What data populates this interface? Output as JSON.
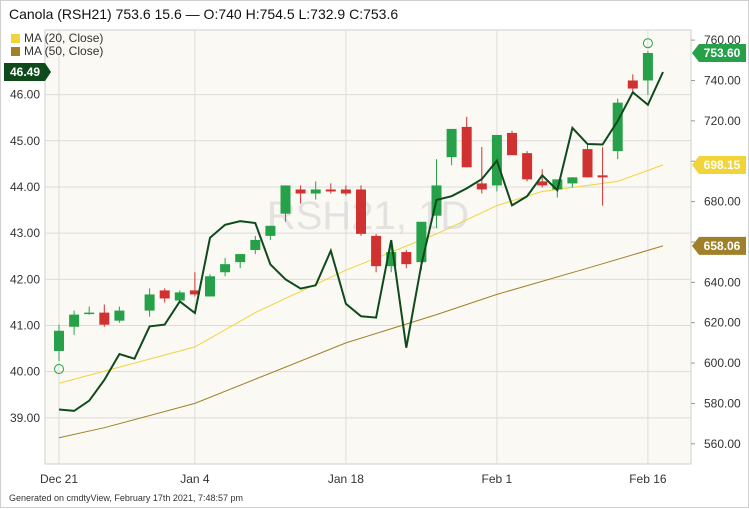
{
  "header": {
    "title": "Canola (RSH21) 753.6 15.6 — O:740 H:754.5 L:732.9 C:753.6"
  },
  "footer": {
    "text": "Generated on cmdtyView, February 17th 2021, 7:48:57 pm"
  },
  "colors": {
    "up": "#26a14a",
    "down": "#d03232",
    "oscillator": "#0f4a1c",
    "ma20": "#f0d43a",
    "ma50": "#a0812a",
    "grid": "#dcdcdc",
    "plot_bg": "#fbf9f3",
    "watermark": "#d9d9d9"
  },
  "chart_data": {
    "type": "candlestick",
    "title": "Canola (RSH21)",
    "watermark": "RSH21, 1D",
    "x_labels": [
      {
        "label": "Dec 21",
        "index": 0
      },
      {
        "label": "Jan 4",
        "index": 9
      },
      {
        "label": "Jan 18",
        "index": 19
      },
      {
        "label": "Feb 1",
        "index": 29
      },
      {
        "label": "Feb 16",
        "index": 39
      }
    ],
    "left_axis": {
      "ticks": [
        "39.00",
        "40.00",
        "41.00",
        "42.00",
        "43.00",
        "44.00",
        "45.00",
        "46.00"
      ],
      "range": [
        38.0,
        47.4
      ],
      "current_label": "46.49",
      "current_value": 46.49,
      "current_color": "#0f4a1c"
    },
    "right_axis": {
      "ticks": [
        "560.00",
        "580.00",
        "600.00",
        "620.00",
        "640.00",
        "660.00",
        "680.00",
        "700.00",
        "720.00",
        "740.00",
        "760.00"
      ],
      "range": [
        550.0,
        765.0
      ],
      "labels": [
        {
          "text": "753.60",
          "value": 753.6,
          "color": "#26a14a",
          "text_color": "#ffffff"
        },
        {
          "text": "698.15",
          "value": 698.15,
          "color": "#f0d43a",
          "text_color": "#ffffff"
        },
        {
          "text": "658.06",
          "value": 658.06,
          "color": "#a0812a",
          "text_color": "#ffffff"
        }
      ]
    },
    "legend": [
      {
        "name": "MA (20, Close)",
        "color": "#f0d43a"
      },
      {
        "name": "MA (50, Close)",
        "color": "#a0812a"
      }
    ],
    "candles": [
      {
        "i": 0,
        "o": 606,
        "h": 619,
        "l": 601,
        "c": 616
      },
      {
        "i": 1,
        "o": 618,
        "h": 626,
        "l": 614,
        "c": 624
      },
      {
        "i": 2,
        "o": 625,
        "h": 628,
        "l": 624,
        "c": 625
      },
      {
        "i": 3,
        "o": 625,
        "h": 629,
        "l": 618,
        "c": 619
      },
      {
        "i": 4,
        "o": 621,
        "h": 628,
        "l": 620,
        "c": 626
      },
      {
        "i": 6,
        "o": 626,
        "h": 637,
        "l": 623,
        "c": 634
      },
      {
        "i": 7,
        "o": 636,
        "h": 637,
        "l": 630,
        "c": 632
      },
      {
        "i": 8,
        "o": 631,
        "h": 636,
        "l": 630,
        "c": 635
      },
      {
        "i": 9,
        "o": 636,
        "h": 645,
        "l": 633,
        "c": 634
      },
      {
        "i": 10,
        "o": 633,
        "h": 644,
        "l": 633,
        "c": 643
      },
      {
        "i": 11,
        "o": 645,
        "h": 652,
        "l": 643,
        "c": 649
      },
      {
        "i": 12,
        "o": 650,
        "h": 654,
        "l": 647,
        "c": 654
      },
      {
        "i": 13,
        "o": 656,
        "h": 663,
        "l": 654,
        "c": 661
      },
      {
        "i": 14,
        "o": 663,
        "h": 668,
        "l": 661,
        "c": 668
      },
      {
        "i": 15,
        "o": 674,
        "h": 688,
        "l": 670,
        "c": 688
      },
      {
        "i": 16,
        "o": 686,
        "h": 688,
        "l": 679,
        "c": 684
      },
      {
        "i": 17,
        "o": 684,
        "h": 690,
        "l": 681,
        "c": 686
      },
      {
        "i": 18,
        "o": 686,
        "h": 689,
        "l": 684,
        "c": 685
      },
      {
        "i": 19,
        "o": 686,
        "h": 688,
        "l": 683,
        "c": 684
      },
      {
        "i": 20,
        "o": 686,
        "h": 688,
        "l": 663,
        "c": 664
      },
      {
        "i": 21,
        "o": 663,
        "h": 664,
        "l": 645,
        "c": 648
      },
      {
        "i": 22,
        "o": 648,
        "h": 659,
        "l": 645,
        "c": 655
      },
      {
        "i": 23,
        "o": 655,
        "h": 656,
        "l": 647,
        "c": 649
      },
      {
        "i": 24,
        "o": 650,
        "h": 665,
        "l": 646,
        "c": 670
      },
      {
        "i": 25,
        "o": 673,
        "h": 701,
        "l": 667,
        "c": 688
      },
      {
        "i": 26,
        "o": 702,
        "h": 715,
        "l": 698,
        "c": 716
      },
      {
        "i": 27,
        "o": 717,
        "h": 722,
        "l": 697,
        "c": 697
      },
      {
        "i": 28,
        "o": 689,
        "h": 707,
        "l": 684,
        "c": 686
      },
      {
        "i": 29,
        "o": 688,
        "h": 712,
        "l": 685,
        "c": 713
      },
      {
        "i": 30,
        "o": 714,
        "h": 715,
        "l": 704,
        "c": 703
      },
      {
        "i": 31,
        "o": 704,
        "h": 705,
        "l": 690,
        "c": 691
      },
      {
        "i": 32,
        "o": 690,
        "h": 696,
        "l": 687,
        "c": 688
      },
      {
        "i": 33,
        "o": 686,
        "h": 691,
        "l": 682,
        "c": 691
      },
      {
        "i": 34,
        "o": 689,
        "h": 692,
        "l": 687,
        "c": 692
      },
      {
        "i": 35,
        "o": 706,
        "h": 708,
        "l": 692,
        "c": 692
      },
      {
        "i": 36,
        "o": 693,
        "h": 707,
        "l": 678,
        "c": 692
      },
      {
        "i": 37,
        "o": 705,
        "h": 731,
        "l": 701,
        "c": 729
      },
      {
        "i": 38,
        "o": 740,
        "h": 743,
        "l": 734,
        "c": 736
      },
      {
        "i": 39,
        "o": 740,
        "h": 754.5,
        "l": 732.9,
        "c": 753.6
      }
    ],
    "ma20": [
      {
        "i": 0,
        "v": 590
      },
      {
        "i": 9,
        "v": 608
      },
      {
        "i": 13,
        "v": 625
      },
      {
        "i": 19,
        "v": 646
      },
      {
        "i": 25,
        "v": 664
      },
      {
        "i": 29,
        "v": 678
      },
      {
        "i": 32,
        "v": 685
      },
      {
        "i": 37,
        "v": 690
      },
      {
        "i": 40,
        "v": 698.15
      }
    ],
    "ma50": [
      {
        "i": 0,
        "v": 563
      },
      {
        "i": 3,
        "v": 568
      },
      {
        "i": 9,
        "v": 580
      },
      {
        "i": 15,
        "v": 598
      },
      {
        "i": 19,
        "v": 610
      },
      {
        "i": 25,
        "v": 624
      },
      {
        "i": 29,
        "v": 634
      },
      {
        "i": 35,
        "v": 647
      },
      {
        "i": 40,
        "v": 658.06
      }
    ],
    "oscillator": [
      {
        "i": 0,
        "v": 39.18
      },
      {
        "i": 1,
        "v": 39.15
      },
      {
        "i": 2,
        "v": 39.37
      },
      {
        "i": 3,
        "v": 39.82
      },
      {
        "i": 4,
        "v": 40.38
      },
      {
        "i": 5,
        "v": 40.28
      },
      {
        "i": 6,
        "v": 40.98
      },
      {
        "i": 7,
        "v": 41.02
      },
      {
        "i": 8,
        "v": 41.52
      },
      {
        "i": 9,
        "v": 41.27
      },
      {
        "i": 10,
        "v": 42.9
      },
      {
        "i": 11,
        "v": 43.18
      },
      {
        "i": 12,
        "v": 43.26
      },
      {
        "i": 13,
        "v": 43.22
      },
      {
        "i": 14,
        "v": 42.32
      },
      {
        "i": 15,
        "v": 42.0
      },
      {
        "i": 16,
        "v": 41.8
      },
      {
        "i": 17,
        "v": 41.87
      },
      {
        "i": 18,
        "v": 42.62
      },
      {
        "i": 19,
        "v": 41.47
      },
      {
        "i": 20,
        "v": 41.2
      },
      {
        "i": 21,
        "v": 41.17
      },
      {
        "i": 22,
        "v": 42.85
      },
      {
        "i": 23,
        "v": 40.52
      },
      {
        "i": 24,
        "v": 42.32
      },
      {
        "i": 25,
        "v": 43.72
      },
      {
        "i": 26,
        "v": 43.8
      },
      {
        "i": 27,
        "v": 43.97
      },
      {
        "i": 28,
        "v": 44.17
      },
      {
        "i": 29,
        "v": 44.57
      },
      {
        "i": 30,
        "v": 43.6
      },
      {
        "i": 31,
        "v": 43.8
      },
      {
        "i": 32,
        "v": 44.25
      },
      {
        "i": 33,
        "v": 43.93
      },
      {
        "i": 34,
        "v": 45.28
      },
      {
        "i": 35,
        "v": 44.93
      },
      {
        "i": 36,
        "v": 44.92
      },
      {
        "i": 37,
        "v": 45.43
      },
      {
        "i": 38,
        "v": 46.05
      },
      {
        "i": 39,
        "v": 45.78
      },
      {
        "i": 40,
        "v": 46.49
      }
    ]
  }
}
